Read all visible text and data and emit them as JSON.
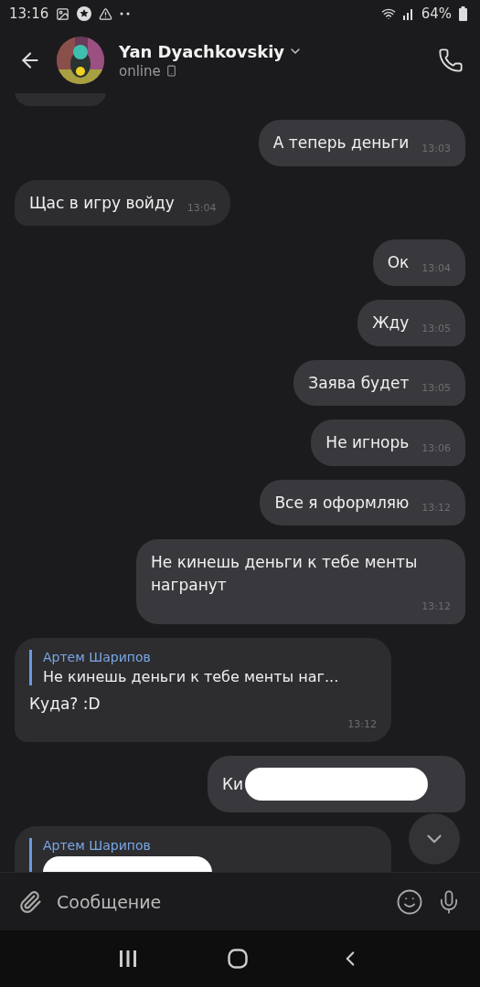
{
  "status_bar": {
    "time": "13:16",
    "battery": "64%"
  },
  "header": {
    "name": "Yan Dyachkovskiy",
    "status": "online"
  },
  "messages": [
    {
      "kind": "stub",
      "outgoing": false
    },
    {
      "kind": "text",
      "outgoing": true,
      "text": "А теперь деньги",
      "time": "13:03"
    },
    {
      "kind": "text",
      "outgoing": false,
      "text": "Щас в игру войду",
      "time": "13:04"
    },
    {
      "kind": "text",
      "outgoing": true,
      "text": "Ок",
      "time": "13:04"
    },
    {
      "kind": "text",
      "outgoing": true,
      "text": "Жду",
      "time": "13:05"
    },
    {
      "kind": "text",
      "outgoing": true,
      "text": "Заява будет",
      "time": "13:05"
    },
    {
      "kind": "text",
      "outgoing": true,
      "text": "Не игнорь",
      "time": "13:06"
    },
    {
      "kind": "text",
      "outgoing": true,
      "text": "Все я оформляю",
      "time": "13:12"
    },
    {
      "kind": "long",
      "outgoing": true,
      "text": "Не кинешь деньги к тебе менты награнут",
      "time": "13:12"
    },
    {
      "kind": "reply",
      "outgoing": false,
      "reply_author": "Артем Шарипов",
      "reply_text": "Не кинешь деньги к тебе менты наг...",
      "text": "Куда? :D",
      "time": "13:12"
    },
    {
      "kind": "redacted",
      "outgoing": true,
      "text": "Ки"
    },
    {
      "kind": "reply_redacted",
      "outgoing": false,
      "reply_author": "Артем Шарипов"
    }
  ],
  "composer": {
    "placeholder": "Сообщение"
  }
}
